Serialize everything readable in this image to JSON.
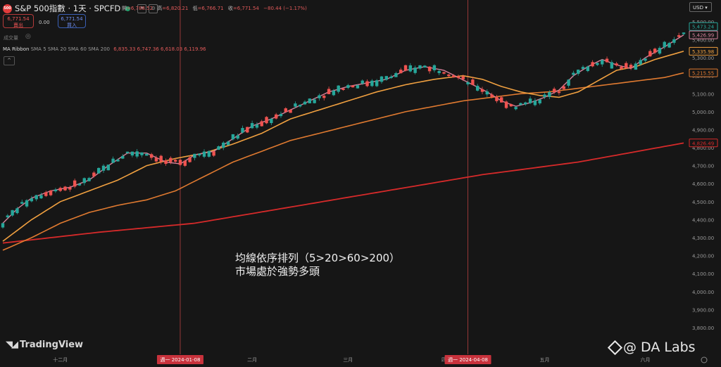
{
  "header": {
    "symbol": "S&P 500指數 · 1天 · SPCFD",
    "logo_text": "500",
    "open_label": "開",
    "open": "=6,788.52",
    "high_label": "高",
    "high": "=6,820.21",
    "low_label": "低",
    "low": "=6,766.71",
    "close_label": "收",
    "close": "=6,771.54",
    "change": "−80.44 (−1.17%)",
    "sell_price": "6,771.54",
    "sell_label": "賣出",
    "buy_price": "6,771.54",
    "buy_label": "買入",
    "spread": "0.00",
    "volume_label": "成交量",
    "ma_title": "MA Ribbon",
    "ma_params": "SMA 5 SMA 20 SMA 60 SMA 200",
    "ma_values": "6,835.33  6,747.36  6,618.03  6,119.96",
    "currency": "USD"
  },
  "annotation": {
    "line1": "均線依序排列（5>20>60>200）",
    "line2": "市場處於強勢多頭"
  },
  "branding": {
    "tradingview": "TradingView",
    "dalabs": "@ DA Labs"
  },
  "colors": {
    "up": "#26a69a",
    "down": "#ef5350",
    "sma5": "#d7819b",
    "sma20": "#f0a040",
    "sma60": "#e07a30",
    "sma200": "#d72a2a",
    "crosshair": "#b84040"
  },
  "chart_data": {
    "type": "candlestick",
    "y_axis": {
      "min": 3800,
      "max": 5500,
      "ticks": [
        3800,
        3900,
        4000,
        4100,
        4200,
        4300,
        4400,
        4500,
        4600,
        4700,
        4800,
        4900,
        5000,
        5100,
        5200,
        5300,
        5400,
        5500
      ],
      "tick_labels": [
        "3,800.00",
        "3,900.00",
        "4,000.00",
        "4,100.00",
        "4,200.00",
        "4,300.00",
        "4,400.00",
        "4,500.00",
        "4,600.00",
        "4,700.00",
        "4,800.00",
        "4,900.00",
        "5,000.00",
        "5,100.00",
        "5,200.00",
        "5,300.00",
        "5,400.00",
        "5,500.00"
      ]
    },
    "x_axis": {
      "labels": [
        {
          "text": "十二月",
          "index": 12
        },
        {
          "text": "二月",
          "index": 52
        },
        {
          "text": "三月",
          "index": 72
        },
        {
          "text": "四",
          "index": 92
        },
        {
          "text": "五月",
          "index": 113
        },
        {
          "text": "六月",
          "index": 134
        }
      ],
      "highlighted": [
        {
          "text": "週一 2024-01-08",
          "index": 37
        },
        {
          "text": "週一 2024-04-08",
          "index": 97
        }
      ]
    },
    "price_labels": [
      {
        "value": 5473.24,
        "text": "5,473.24",
        "series": "up"
      },
      {
        "value": 5426.99,
        "text": "5,426.99",
        "series": "sma5"
      },
      {
        "value": 5335.98,
        "text": "5,335.98",
        "series": "sma20"
      },
      {
        "value": 5215.55,
        "text": "5,215.55",
        "series": "sma60"
      },
      {
        "value": 4826.49,
        "text": "4,826.49",
        "series": "sma200"
      }
    ],
    "series": [
      {
        "name": "SMA 5",
        "key": "sma5",
        "anchors": [
          [
            0,
            4380
          ],
          [
            3,
            4460
          ],
          [
            6,
            4520
          ],
          [
            10,
            4560
          ],
          [
            14,
            4580
          ],
          [
            18,
            4620
          ],
          [
            22,
            4700
          ],
          [
            26,
            4770
          ],
          [
            30,
            4770
          ],
          [
            34,
            4720
          ],
          [
            37,
            4710
          ],
          [
            40,
            4760
          ],
          [
            44,
            4780
          ],
          [
            48,
            4850
          ],
          [
            52,
            4920
          ],
          [
            56,
            4960
          ],
          [
            60,
            5010
          ],
          [
            64,
            5060
          ],
          [
            68,
            5110
          ],
          [
            72,
            5140
          ],
          [
            76,
            5160
          ],
          [
            80,
            5180
          ],
          [
            84,
            5230
          ],
          [
            88,
            5250
          ],
          [
            92,
            5230
          ],
          [
            95,
            5190
          ],
          [
            98,
            5150
          ],
          [
            101,
            5110
          ],
          [
            104,
            5060
          ],
          [
            107,
            5030
          ],
          [
            110,
            5050
          ],
          [
            113,
            5080
          ],
          [
            116,
            5120
          ],
          [
            119,
            5200
          ],
          [
            122,
            5250
          ],
          [
            125,
            5290
          ],
          [
            128,
            5260
          ],
          [
            131,
            5240
          ],
          [
            134,
            5300
          ],
          [
            138,
            5360
          ],
          [
            142,
            5427
          ]
        ]
      },
      {
        "name": "SMA 20",
        "key": "sma20",
        "anchors": [
          [
            0,
            4280
          ],
          [
            6,
            4400
          ],
          [
            12,
            4500
          ],
          [
            18,
            4560
          ],
          [
            24,
            4620
          ],
          [
            30,
            4700
          ],
          [
            36,
            4740
          ],
          [
            42,
            4770
          ],
          [
            48,
            4820
          ],
          [
            54,
            4880
          ],
          [
            60,
            4960
          ],
          [
            66,
            5010
          ],
          [
            72,
            5060
          ],
          [
            78,
            5110
          ],
          [
            84,
            5150
          ],
          [
            90,
            5180
          ],
          [
            96,
            5200
          ],
          [
            100,
            5180
          ],
          [
            104,
            5140
          ],
          [
            108,
            5110
          ],
          [
            112,
            5090
          ],
          [
            116,
            5080
          ],
          [
            120,
            5110
          ],
          [
            124,
            5170
          ],
          [
            128,
            5230
          ],
          [
            132,
            5250
          ],
          [
            136,
            5290
          ],
          [
            142,
            5336
          ]
        ]
      },
      {
        "name": "SMA 60",
        "key": "sma60",
        "anchors": [
          [
            0,
            4230
          ],
          [
            6,
            4300
          ],
          [
            12,
            4380
          ],
          [
            18,
            4440
          ],
          [
            24,
            4480
          ],
          [
            30,
            4510
          ],
          [
            36,
            4560
          ],
          [
            42,
            4640
          ],
          [
            48,
            4720
          ],
          [
            54,
            4780
          ],
          [
            60,
            4840
          ],
          [
            66,
            4880
          ],
          [
            72,
            4920
          ],
          [
            78,
            4960
          ],
          [
            84,
            5000
          ],
          [
            90,
            5030
          ],
          [
            96,
            5060
          ],
          [
            102,
            5080
          ],
          [
            108,
            5100
          ],
          [
            114,
            5110
          ],
          [
            120,
            5130
          ],
          [
            126,
            5150
          ],
          [
            132,
            5170
          ],
          [
            138,
            5190
          ],
          [
            142,
            5216
          ]
        ]
      },
      {
        "name": "SMA 200",
        "key": "sma200",
        "anchors": [
          [
            0,
            4270
          ],
          [
            20,
            4330
          ],
          [
            40,
            4380
          ],
          [
            60,
            4470
          ],
          [
            80,
            4560
          ],
          [
            100,
            4650
          ],
          [
            120,
            4720
          ],
          [
            142,
            4826
          ]
        ]
      }
    ]
  }
}
